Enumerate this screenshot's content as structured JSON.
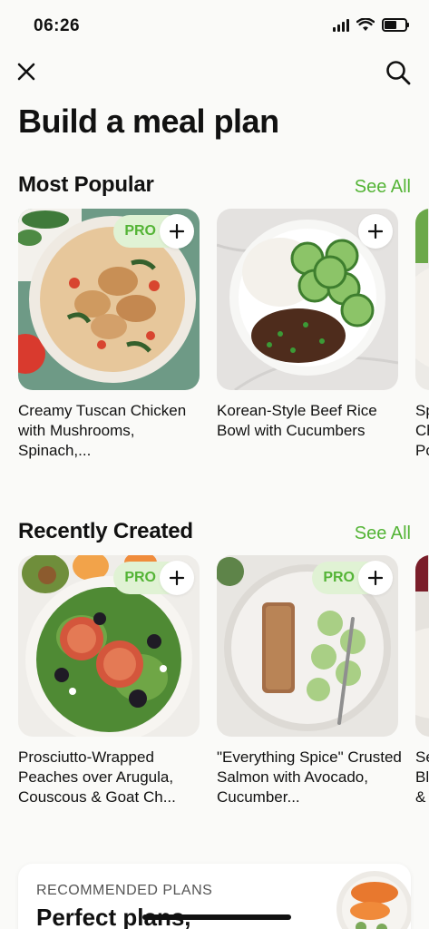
{
  "status_bar": {
    "time": "06:26"
  },
  "icons": {
    "close": "close-icon",
    "search": "search-icon",
    "add": "plus-icon"
  },
  "page": {
    "title": "Build a meal plan"
  },
  "sections": {
    "popular": {
      "title": "Most Popular",
      "see_all": "See All",
      "cards": [
        {
          "title": "Creamy Tuscan Chicken with Mushrooms, Spinach,...",
          "pro": "PRO"
        },
        {
          "title": "Korean-Style Beef Rice Bowl with Cucumbers",
          "pro": ""
        },
        {
          "title": "Sp Ch Po",
          "pro": ""
        }
      ]
    },
    "recent": {
      "title": "Recently Created",
      "see_all": "See All",
      "cards": [
        {
          "title": "Prosciutto-Wrapped Peaches over Arugula, Couscous & Goat Ch...",
          "pro": "PRO"
        },
        {
          "title": "\"Everything Spice\" Crusted Salmon with Avocado, Cucumber...",
          "pro": "PRO"
        },
        {
          "title": "Se Bl &",
          "pro": ""
        }
      ]
    }
  },
  "recommended": {
    "label": "RECOMMENDED PLANS",
    "title": "Perfect plans,"
  },
  "colors": {
    "accent": "#54B436",
    "pro_bg": "#E0F2D4",
    "background": "#FAFAF8"
  }
}
